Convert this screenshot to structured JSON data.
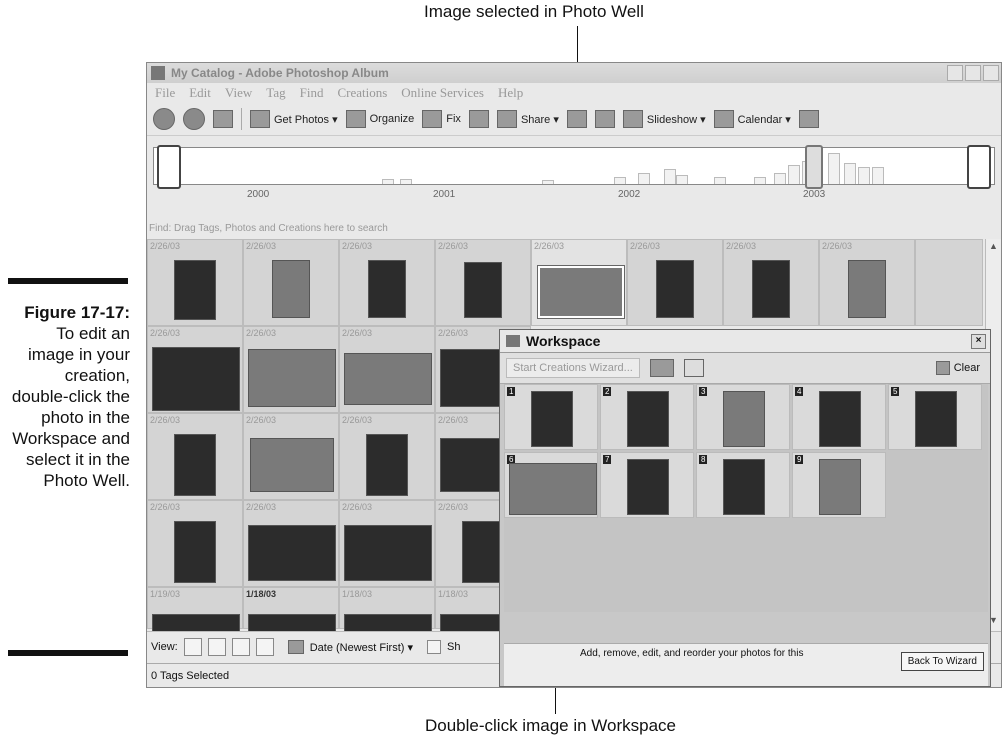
{
  "callouts": {
    "top": "Image selected in Photo Well",
    "bottom": "Double-click image in Workspace"
  },
  "figure": {
    "number": "Figure 17-17:",
    "caption": "To edit an image in your creation, double-click the photo in the Workspace and select it in the Photo Well."
  },
  "app": {
    "title": "My Catalog - Adobe Photoshop Album",
    "menu": [
      "File",
      "Edit",
      "View",
      "Tag",
      "Find",
      "Creations",
      "Online Services",
      "Help"
    ],
    "toolbar": {
      "get_photos": "Get Photos ▾",
      "organize": "Organize",
      "fix": "Fix",
      "share": "Share ▾",
      "slideshow": "Slideshow ▾",
      "calendar": "Calendar ▾"
    },
    "timeline_years": [
      "2000",
      "2001",
      "2002",
      "2003"
    ],
    "find_bar": "Find: Drag Tags, Photos and Creations here to search",
    "well_dates": [
      [
        "2/26/03",
        "2/26/03",
        "2/26/03",
        "2/26/03",
        "2/26/03",
        "2/26/03",
        "2/26/03",
        "2/26/03"
      ],
      [
        "2/26/03",
        "2/26/03",
        "2/26/03",
        "2/26/03"
      ],
      [
        "2/26/03",
        "2/26/03",
        "2/26/03",
        "2/26/03"
      ],
      [
        "2/26/03",
        "2/26/03",
        "2/26/03",
        "2/26/03"
      ],
      [
        "1/19/03",
        "1/18/03",
        "1/18/03",
        "1/18/03"
      ]
    ],
    "view_label": "View:",
    "sort": "Date (Newest First) ▾",
    "show_label": "Sh",
    "status": "0 Tags Selected"
  },
  "workspace": {
    "title": "Workspace",
    "start_wizard": "Start Creations Wizard...",
    "clear": "Clear",
    "items": [
      "1",
      "2",
      "3",
      "4",
      "5",
      "6",
      "7",
      "8",
      "9"
    ],
    "footer_message": "Add, remove, edit, and reorder your photos for this",
    "back_button": "Back To Wizard"
  }
}
